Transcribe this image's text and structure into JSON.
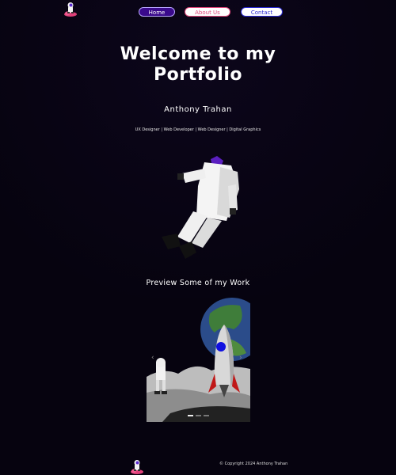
{
  "nav": {
    "home": "Home",
    "about": "About Us",
    "contact": "Contact"
  },
  "hero": {
    "title_line1": "Welcome to my",
    "title_line2": "Portfolio",
    "name": "Anthony Trahan",
    "roles": "UX Designer | Web Developer | Web Designer | Digital Graphics"
  },
  "work": {
    "title": "Preview Some of my Work",
    "slide_count": 3,
    "active_slide": 1
  },
  "footer": {
    "copyright": "© Copyright 2024 Anthony Trahan"
  },
  "colors": {
    "background": "#06030f",
    "home_button": "#3a0a8c",
    "about_accent": "#e0467a",
    "contact_accent": "#2a2ad0"
  },
  "icons": {
    "logo": "astronaut-on-pink-cloud-icon",
    "prev": "chevron-left-icon",
    "next": "chevron-right-icon"
  }
}
